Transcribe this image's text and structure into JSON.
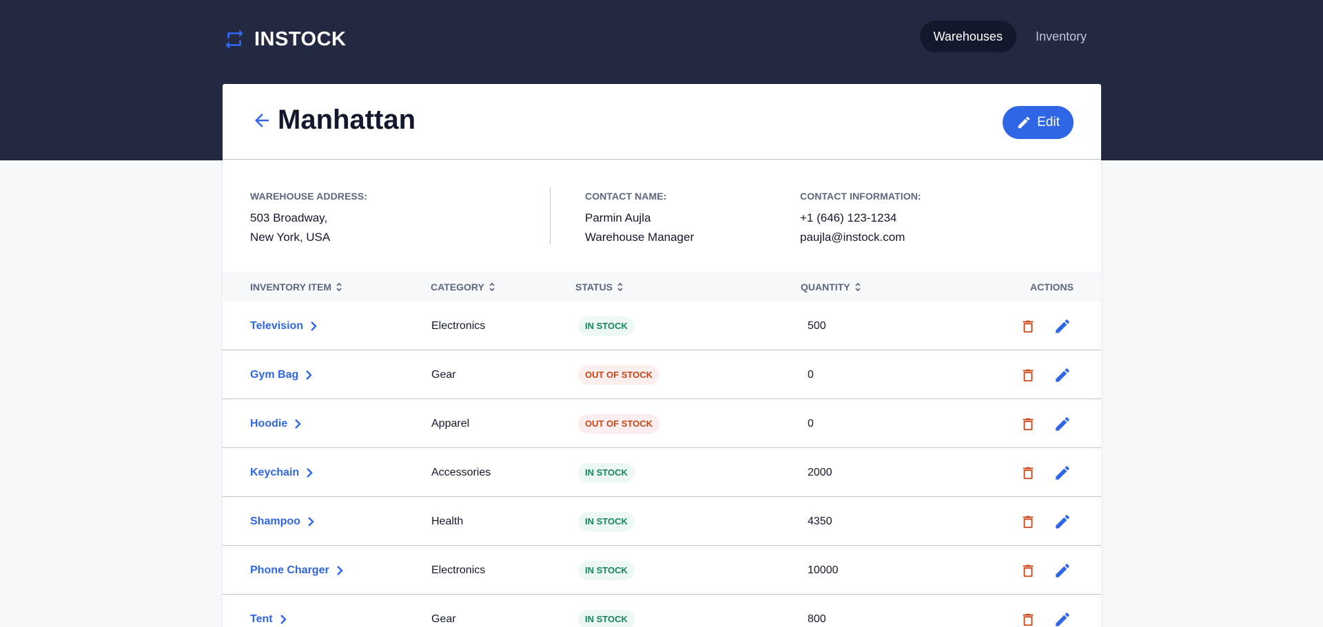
{
  "brand": {
    "name": "INSTOCK",
    "accent": "#2e66e6",
    "header_bg": "#232940"
  },
  "nav": {
    "items": [
      "Warehouses",
      "Inventory"
    ],
    "active": "Warehouses"
  },
  "page": {
    "title": "Manhattan",
    "edit_label": "Edit"
  },
  "details": {
    "address": {
      "label": "WAREHOUSE ADDRESS:",
      "lines": [
        "503 Broadway,",
        "New York, USA"
      ]
    },
    "contact_name": {
      "label": "CONTACT NAME:",
      "lines": [
        "Parmin Aujla",
        "Warehouse Manager"
      ]
    },
    "contact_info": {
      "label": "CONTACT INFORMATION:",
      "lines": [
        "+1 (646) 123-1234",
        "paujla@instock.com"
      ]
    }
  },
  "table": {
    "columns": [
      "INVENTORY ITEM",
      "CATEGORY",
      "STATUS",
      "QUANTITY",
      "ACTIONS"
    ],
    "rows": [
      {
        "item": "Television",
        "category": "Electronics",
        "status": "IN STOCK",
        "quantity": "500"
      },
      {
        "item": "Gym Bag",
        "category": "Gear",
        "status": "OUT OF STOCK",
        "quantity": "0"
      },
      {
        "item": "Hoodie",
        "category": "Apparel",
        "status": "OUT OF STOCK",
        "quantity": "0"
      },
      {
        "item": "Keychain",
        "category": "Accessories",
        "status": "IN STOCK",
        "quantity": "2000"
      },
      {
        "item": "Shampoo",
        "category": "Health",
        "status": "IN STOCK",
        "quantity": "4350"
      },
      {
        "item": "Phone Charger",
        "category": "Electronics",
        "status": "IN STOCK",
        "quantity": "10000"
      },
      {
        "item": "Tent",
        "category": "Gear",
        "status": "IN STOCK",
        "quantity": "800"
      }
    ]
  },
  "icons": {
    "logo": "swap-arrows-icon",
    "back": "arrow-left-icon",
    "edit": "pencil-icon",
    "delete": "trash-icon",
    "sort": "sort-icon",
    "chevron": "chevron-right-icon"
  },
  "status_colors": {
    "in_stock": "#158463",
    "out_of_stock": "#c94515",
    "delete": "#c94515"
  }
}
